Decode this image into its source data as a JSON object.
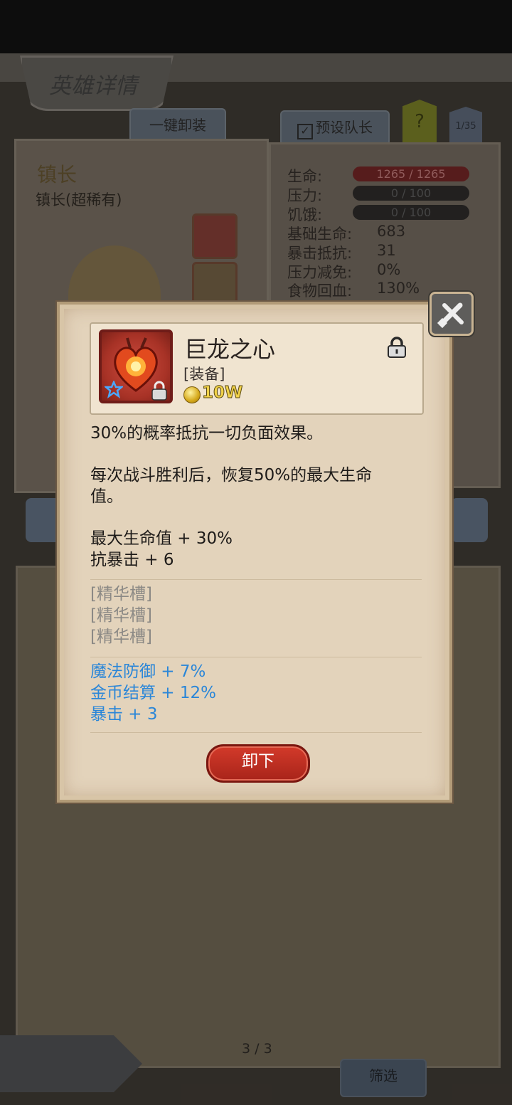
{
  "header": {
    "title": "英雄详情"
  },
  "toolbar": {
    "unequip_all": "一键卸装",
    "preset_captain": "预设队长",
    "help": "?",
    "counter": "1/35"
  },
  "hero": {
    "name": "镇长",
    "subtitle": "镇长(超稀有)"
  },
  "stats": [
    {
      "label": "生命:",
      "value": "1265 / 1265"
    },
    {
      "label": "压力:",
      "value": "0 / 100"
    },
    {
      "label": "饥饿:",
      "value": "0 / 100"
    },
    {
      "label": "基础生命:",
      "value": "683"
    },
    {
      "label": "暴击抵抗:",
      "value": "31"
    },
    {
      "label": "压力减免:",
      "value": "0%"
    },
    {
      "label": "食物回血:",
      "value": "130%"
    }
  ],
  "pager": {
    "text": "3 / 3"
  },
  "filter_label": "筛选",
  "item": {
    "name": "巨龙之心",
    "type": "[装备]",
    "price": "10W",
    "desc1": "30%的概率抵抗一切负面效果。",
    "desc2_line1": "每次战斗胜利后，恢复50%的最大生命",
    "desc2_line2": "值。",
    "bonus1": "最大生命值 + 30%",
    "bonus2": "抗暴击 + 6",
    "slot1": "[精华槽]",
    "slot2": "[精华槽]",
    "slot3": "[精华槽]",
    "extra1": "魔法防御 + 7%",
    "extra2": "金币结算 + 12%",
    "extra3": "暴击 + 3",
    "unequip_button": "卸下"
  },
  "colors": {
    "modal_bg": "#e3d3bb",
    "button_red": "#c9301f",
    "extra_text_blue": "#2a86d8",
    "slot_gray": "#8b8985",
    "coin_gold": "#f1d24a"
  }
}
